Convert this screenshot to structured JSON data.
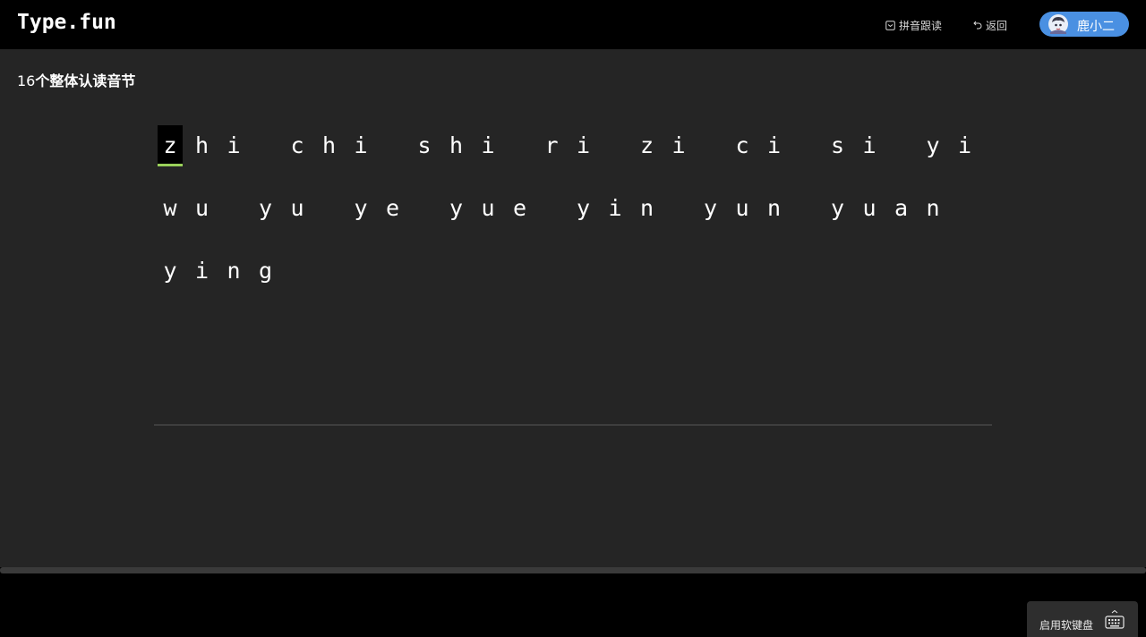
{
  "header": {
    "logo": "Type.fun",
    "nav": {
      "pinyin_label": "拼音跟读",
      "back_label": "返回"
    },
    "user": {
      "name": "鹿小二"
    }
  },
  "lesson": {
    "count": "16",
    "name": "个整体认读音节"
  },
  "typing": {
    "lines": [
      [
        "zhi",
        "chi",
        "shi",
        "ri",
        "zi",
        "ci",
        "si",
        "yi"
      ],
      [
        "wu",
        "yu",
        "ye",
        "yue",
        "yin",
        "yun",
        "yuan"
      ],
      [
        "ying"
      ]
    ],
    "current_index": 0
  },
  "footer": {
    "keyboard_label": "启用软键盘"
  },
  "colors": {
    "accent": "#9ad15a",
    "user_pill": "#4a90e2",
    "background": "#252525"
  }
}
